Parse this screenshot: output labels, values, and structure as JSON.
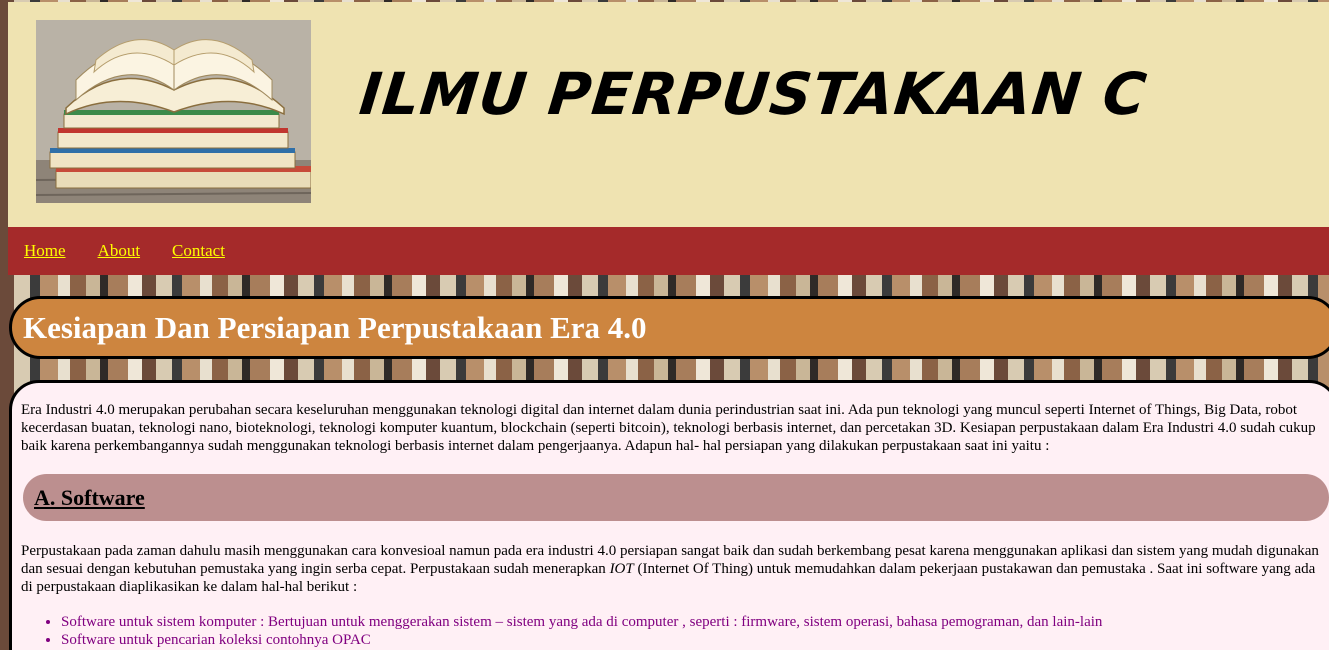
{
  "header": {
    "title": "ILMU PERPUSTAKAAN C",
    "logo": "open-books-image"
  },
  "nav": {
    "items": [
      {
        "label": "Home"
      },
      {
        "label": "About"
      },
      {
        "label": "Contact"
      }
    ]
  },
  "article": {
    "title": "Kesiapan Dan Persiapan Perpustakaan Era 4.0",
    "intro": "Era Industri 4.0 merupakan perubahan secara keseluruhan menggunakan teknologi digital dan internet dalam dunia perindustrian saat ini. Ada pun teknologi yang muncul seperti Internet of Things, Big Data, robot kecerdasan buatan, teknologi nano, bioteknologi, teknologi komputer kuantum, blockchain (seperti bitcoin), teknologi berbasis internet, dan percetakan 3D. Kesiapan perpustakaan dalam Era Industri 4.0 sudah cukup baik karena perkembangannya sudah menggunakan teknologi berbasis internet dalam pengerjaanya. Adapun hal- hal persiapan yang dilakukan perpustakaan saat ini yaitu :",
    "section_a": {
      "title": "A. Software",
      "text_before": "Perpustakaan pada zaman dahulu masih menggunakan cara konvesioal namun pada era industri 4.0 persiapan sangat baik dan sudah berkembang pesat karena menggunakan aplikasi dan sistem yang mudah digunakan dan sesuai dengan kebutuhan pemustaka yang ingin serba cepat. Perpustakaan sudah menerapkan ",
      "text_em": "IOT",
      "text_after": " (Internet Of Thing) untuk memudahkan dalam pekerjaan pustakawan dan pemustaka . Saat ini software yang ada di perpustakaan diaplikasikan ke dalam hal-hal berikut :",
      "items": [
        "Software untuk sistem komputer : Bertujuan untuk menggerakan sistem – sistem yang ada di computer , seperti : firmware, sistem operasi, bahasa pemograman, dan lain-lain",
        "Software untuk pencarian koleksi contohnya OPAC"
      ]
    }
  },
  "colors": {
    "header_bg": "#efe3b1",
    "nav_bg": "#a52a2a",
    "nav_link": "#ffff00",
    "article_head_bg": "#cd853f",
    "content_bg": "#fff0f5",
    "section_head_bg": "#bc8f8f",
    "list_text": "#800080"
  }
}
